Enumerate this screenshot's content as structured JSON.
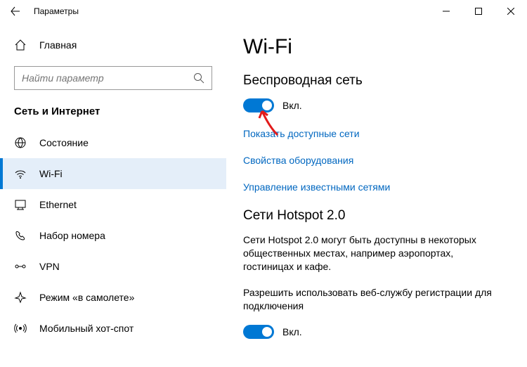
{
  "window": {
    "title": "Параметры"
  },
  "sidebar": {
    "home_label": "Главная",
    "search_placeholder": "Найти параметр",
    "section_title": "Сеть и Интернет",
    "items": [
      {
        "label": "Состояние"
      },
      {
        "label": "Wi-Fi"
      },
      {
        "label": "Ethernet"
      },
      {
        "label": "Набор номера"
      },
      {
        "label": "VPN"
      },
      {
        "label": "Режим «в самолете»"
      },
      {
        "label": "Мобильный хот-спот"
      }
    ]
  },
  "content": {
    "page_title": "Wi-Fi",
    "wifi_heading": "Беспроводная сеть",
    "wifi_toggle_label": "Вкл.",
    "link_show_networks": "Показать доступные сети",
    "link_hardware": "Свойства оборудования",
    "link_known_networks": "Управление известными сетями",
    "hotspot_heading": "Сети Hotspot 2.0",
    "hotspot_body": "Сети Hotspot 2.0 могут быть доступны в некоторых общественных местах, например аэропортах, гостиницах и кафе.",
    "hotspot_allow": "Разрешить использовать веб-службу регистрации для подключения",
    "hotspot_toggle_label": "Вкл."
  }
}
